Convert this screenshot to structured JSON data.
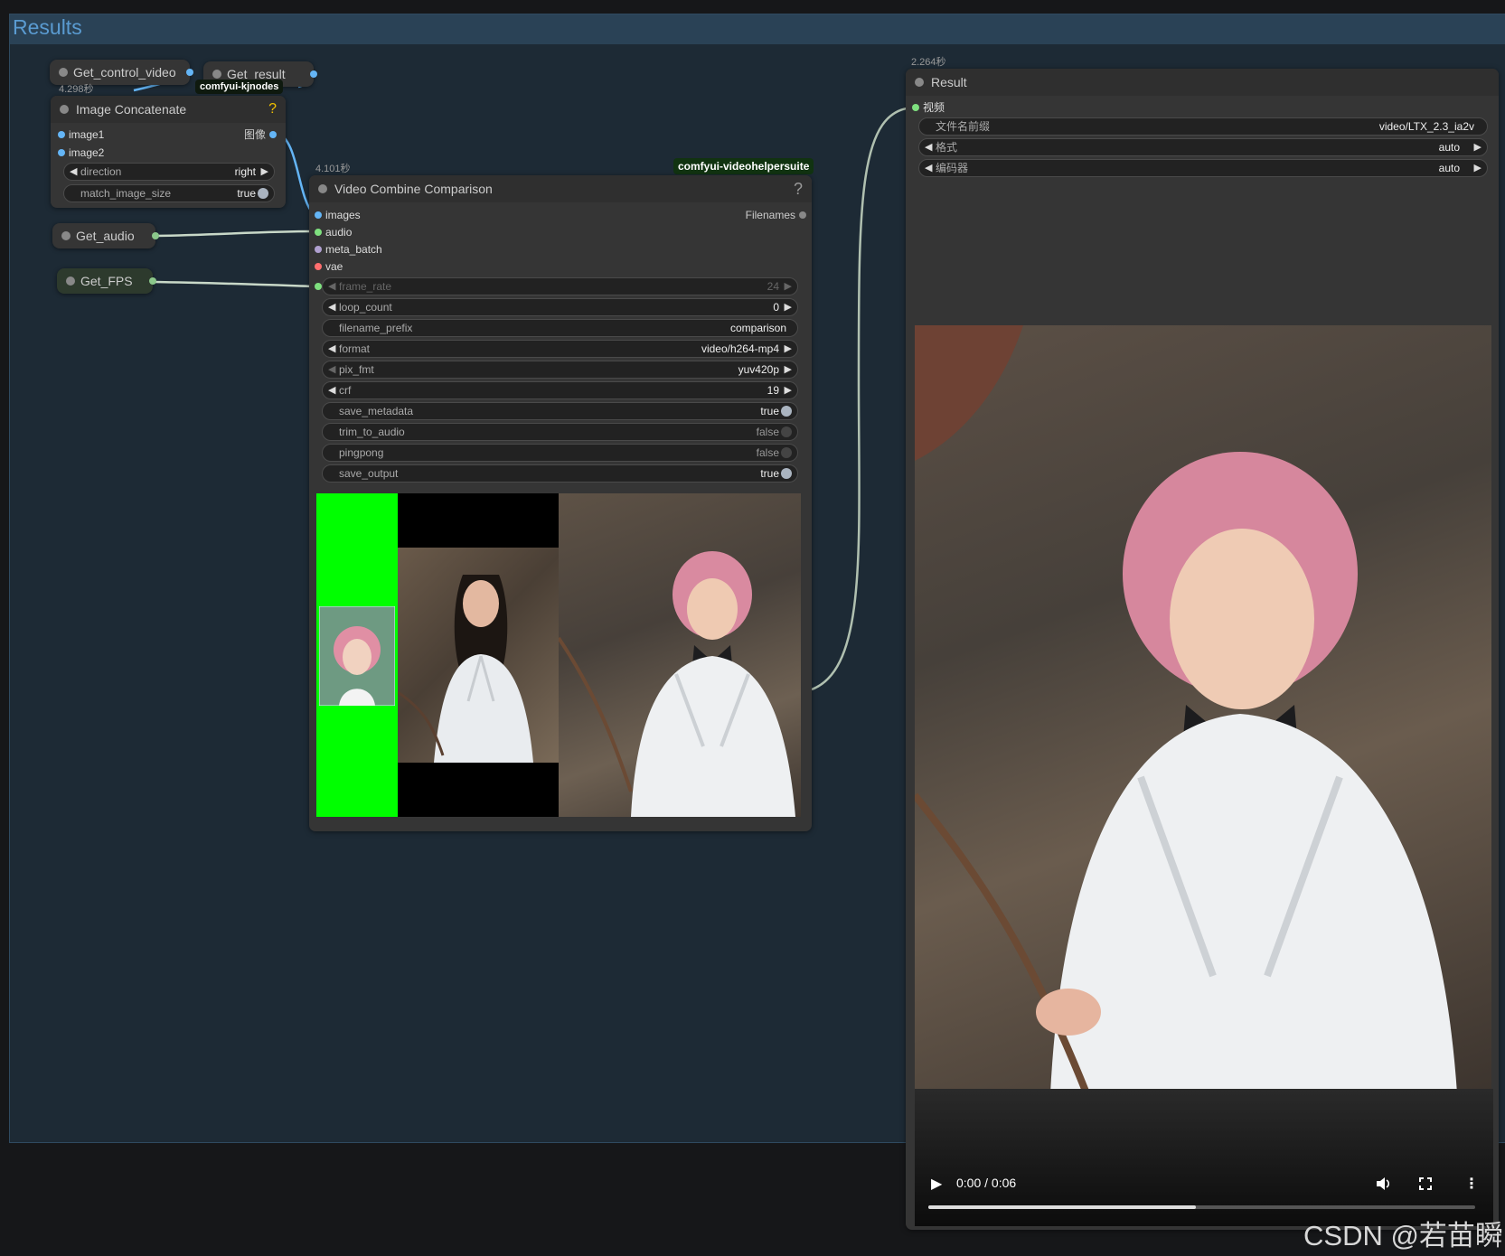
{
  "group": {
    "title": "Results"
  },
  "badges": {
    "image_concat_timer": "4.298秒",
    "comfyui_kjnodes": "comfyui-kjnodes",
    "video_combine_timer": "4.101秒",
    "videohelpersuite": "comfyui-videohelpersuite",
    "result_timer": "2.264秒"
  },
  "get_nodes": {
    "control_video": "Get_control_video",
    "result": "Get_result",
    "audio": "Get_audio",
    "fps": "Get_FPS"
  },
  "image_concat": {
    "title": "Image Concatenate",
    "help": "?",
    "inputs": [
      "image1",
      "image2"
    ],
    "output": "图像",
    "widgets": {
      "direction": {
        "label": "direction",
        "value": "right"
      },
      "match_image_size": {
        "label": "match_image_size",
        "value": "true"
      }
    }
  },
  "video_combine": {
    "title": "Video Combine Comparison",
    "help": "?",
    "inputs": [
      "images",
      "audio",
      "meta_batch",
      "vae"
    ],
    "output": "Filenames",
    "widgets": {
      "frame_rate": {
        "label": "frame_rate",
        "value": "24"
      },
      "loop_count": {
        "label": "loop_count",
        "value": "0"
      },
      "filename_prefix": {
        "label": "filename_prefix",
        "value": "comparison"
      },
      "format": {
        "label": "format",
        "value": "video/h264-mp4"
      },
      "pix_fmt": {
        "label": "pix_fmt",
        "value": "yuv420p"
      },
      "crf": {
        "label": "crf",
        "value": "19"
      },
      "save_metadata": {
        "label": "save_metadata",
        "value": "true"
      },
      "trim_to_audio": {
        "label": "trim_to_audio",
        "value": "false"
      },
      "pingpong": {
        "label": "pingpong",
        "value": "false"
      },
      "save_output": {
        "label": "save_output",
        "value": "true"
      }
    }
  },
  "result": {
    "title": "Result",
    "input": "视频",
    "widgets": {
      "prefix": {
        "label": "文件名前缀",
        "value": "video/LTX_2.3_ia2v"
      },
      "fmt": {
        "label": "格式",
        "value": "auto"
      },
      "encoder": {
        "label": "编码器",
        "value": "auto"
      }
    },
    "player": {
      "time": "0:00 / 0:06",
      "progress": 0.49
    }
  },
  "colors": {
    "image_slot": "#64b5f6",
    "audio_slot": "#7fe07f",
    "latent_slot": "#b0a0d0",
    "vae_slot": "#ff6e6e",
    "green_screen": "#00ff00",
    "group_title": "#5a9bd1"
  },
  "watermark": "CSDN @若苗瞬"
}
